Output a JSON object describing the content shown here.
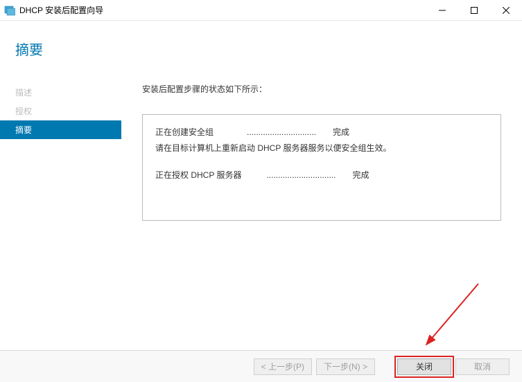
{
  "window": {
    "title": "DHCP 安装后配置向导"
  },
  "header": {
    "title": "摘要"
  },
  "sidebar": {
    "items": [
      {
        "label": "描述",
        "active": false
      },
      {
        "label": "授权",
        "active": false
      },
      {
        "label": "摘要",
        "active": true
      }
    ]
  },
  "main": {
    "instruction": "安装后配置步骤的状态如下所示：",
    "status_lines": [
      "正在创建安全组    ..............................  完成",
      "请在目标计算机上重新启动 DHCP 服务器服务以便安全组生效。",
      "",
      "正在授权 DHCP 服务器   ..............................  完成"
    ]
  },
  "buttons": {
    "prev": "< 上一步(P)",
    "next": "下一步(N) >",
    "close": "关闭",
    "cancel": "取消"
  }
}
